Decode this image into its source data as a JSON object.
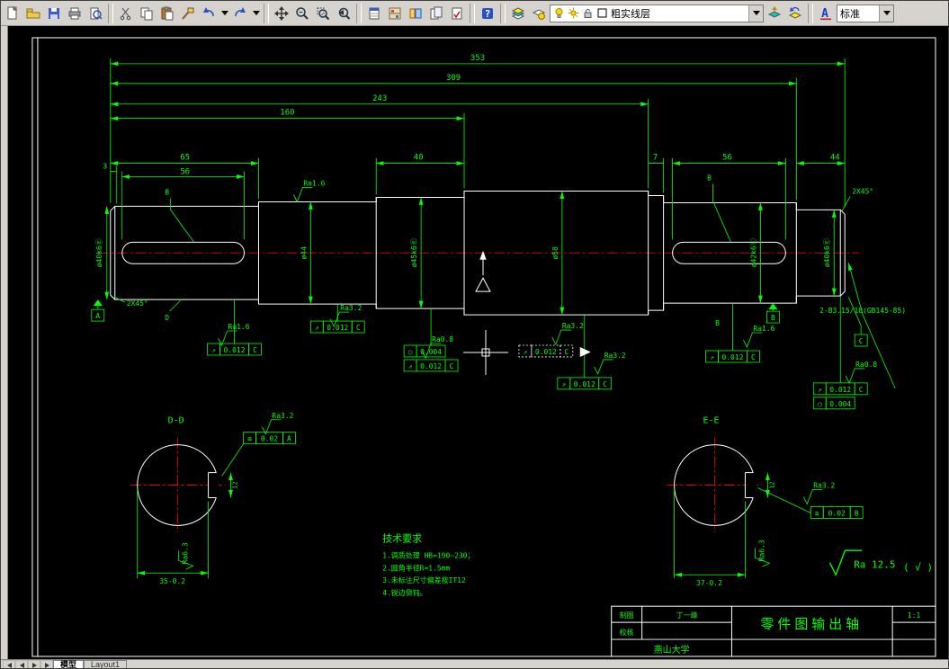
{
  "toolbar": {
    "layer_value": "粗实线层",
    "style_value": "标准",
    "help_glyph": "?",
    "style_icon_glyph": "A"
  },
  "tabs": {
    "model": "模型",
    "layout": "Layout1"
  },
  "drawing": {
    "dims": {
      "total": "353",
      "len2": "309",
      "len3": "243",
      "len4": "160",
      "seg3": "3",
      "seg65": "65",
      "key56l": "56",
      "seg40": "40",
      "seg7": "7",
      "key56r": "56",
      "seg44": "44",
      "chamfer_r": "2X45°",
      "chamfer_l": "2X45°",
      "dd_depth": "35-0.2",
      "ee_depth": "37-0.2",
      "dd_width": "12",
      "ee_width": "12"
    },
    "dia": [
      "ø40k6Ⓔ",
      "ø44",
      "ø45k6Ⓔ",
      "ø58",
      "ø42k6Ⓔ",
      "ø40k6Ⓔ"
    ],
    "rough": [
      "Ra1.6",
      "Ra1.6",
      "Ra3.2",
      "Ra0.8",
      "Ra3.2",
      "Ra3.2",
      "Ra1.6",
      "Ra0.8",
      "Ra3.2",
      "Ra3.2",
      "Ra6.3",
      "Ra6.3"
    ],
    "rest_rough": {
      "value": "Ra 12.5",
      "suffix": "( √ )"
    },
    "frames": [
      {
        "sym": "↗",
        "val": "0.012",
        "ref": "C"
      },
      {
        "sym": "↗",
        "val": "0.012",
        "ref": "C"
      },
      {
        "sym": "○",
        "val": "0.004"
      },
      {
        "sym": "↗",
        "val": "0.012",
        "ref": "C"
      },
      {
        "sym": "↗",
        "val": "0.012",
        "ref": "C"
      },
      {
        "sym": "↗",
        "val": "0.012",
        "ref": "C"
      },
      {
        "sym": "↗",
        "val": "0.012",
        "ref": "C"
      },
      {
        "sym": "↗",
        "val": "0.012",
        "ref": "C"
      },
      {
        "sym": "○",
        "val": "0.004"
      },
      {
        "sym": "≡",
        "val": "0.02",
        "ref": "A"
      },
      {
        "sym": "≡",
        "val": "0.02",
        "ref": "B"
      }
    ],
    "datums": {
      "a": "A",
      "b": "B",
      "c": "C",
      "d": "D"
    },
    "sections": {
      "dd": "D-D",
      "ee": "E-E"
    },
    "center_note": "2-B3.15/10(GB145-85)",
    "tech": {
      "title": "技术要求",
      "line1": "1.调质处理 HB=190~230；",
      "line2": "2.圆角半径R=1.5mm",
      "line3": "3.未标注尺寸偏差按IT12",
      "line4": "4.锐边倒钝。"
    },
    "titleblock": {
      "drawn_label": "制图",
      "drawn_value": "丁一峰",
      "check_label": "校核",
      "school": "燕山大学",
      "title": "零件图输出轴",
      "scale": "1:1"
    }
  }
}
